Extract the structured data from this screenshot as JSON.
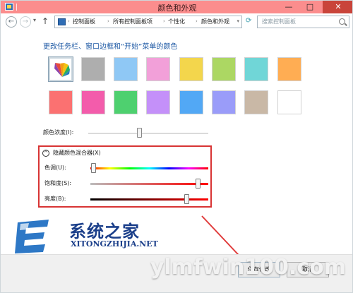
{
  "window": {
    "title": "颜色和外观",
    "minimize_label": "—",
    "maximize_label": "□",
    "close_label": "✕",
    "title_color": "#fb8d8d",
    "close_color": "#c9443a"
  },
  "nav": {
    "back_label": "←",
    "forward_label": "→",
    "dropdown_label": "▾",
    "up_label": "↑",
    "breadcrumb": [
      "控制面板",
      "所有控制面板项",
      "个性化",
      "颜色和外观"
    ],
    "breadcrumb_sep": "›",
    "address_dropdown": "▾",
    "refresh_label": "⟳",
    "search_placeholder": "搜索控制面板"
  },
  "page": {
    "heading": "更改任务栏、窗口边框和“开始”菜单的颜色",
    "swatches_row1": [
      "auto",
      "#aeaeae",
      "#8fc8f5",
      "#f2a0d9",
      "#f3d64c",
      "#acd763",
      "#70d6d7",
      "#ffad53"
    ],
    "swatches_row2": [
      "#fb7171",
      "#f35cab",
      "#4ed06f",
      "#c490f9",
      "#52a8f5",
      "#9a9cf9",
      "#c9b8a6",
      "#ffffff"
    ],
    "selected_swatch": "auto",
    "intensity_label": "颜色浓度(I):",
    "intensity_value_percent": 43
  },
  "mixer": {
    "title": "隐藏颜色混合器(X)",
    "toggle_icon": "^",
    "hue_label": "色调(U):",
    "saturation_label": "饱和度(S):",
    "brightness_label": "亮度(B):",
    "hue_value_percent": 4,
    "saturation_value_percent": 94,
    "brightness_value_percent": 80,
    "border_color": "#d83434"
  },
  "footer": {
    "save_label": "保存修改",
    "cancel_label": "取消"
  },
  "watermark": {
    "logo_text": "系统之家",
    "logo_url": "XITONGZHIJIA.NET",
    "brand": "ylmfwin100.com"
  }
}
